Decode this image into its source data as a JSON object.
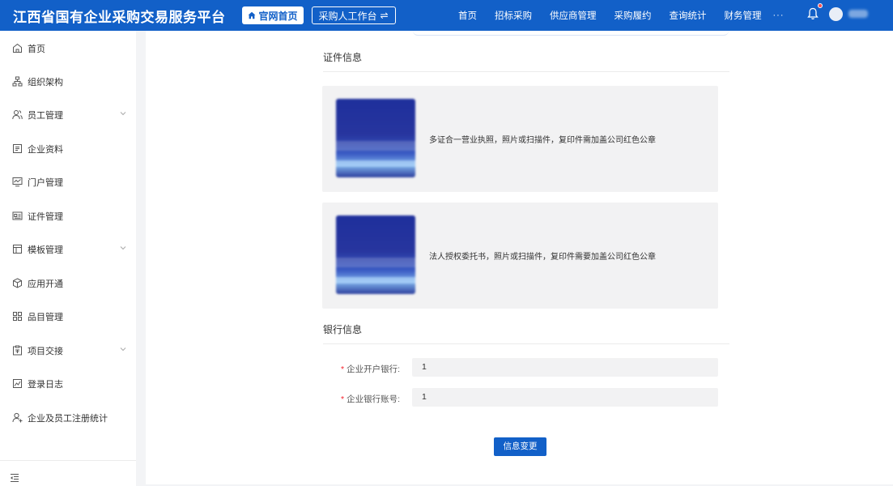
{
  "header": {
    "app_title": "江西省国有企业采购交易服务平台",
    "home_button": "官网首页",
    "switch_button": "采购人工作台",
    "nav": [
      "首页",
      "招标采购",
      "供应商管理",
      "采购履约",
      "查询统计",
      "财务管理"
    ],
    "more": "···",
    "icons": {
      "home": "home-icon",
      "switch": "switch-arrows-icon",
      "bell": "bell-icon",
      "avatar": "avatar"
    },
    "colors": {
      "brand": "#1260c8",
      "notification_dot": "#ff4d4f"
    }
  },
  "sidebar": {
    "items": [
      {
        "label": "首页",
        "icon": "home-outline-icon",
        "expandable": false
      },
      {
        "label": "组织架构",
        "icon": "org-chart-icon",
        "expandable": false
      },
      {
        "label": "员工管理",
        "icon": "users-icon",
        "expandable": true
      },
      {
        "label": "企业资料",
        "icon": "document-icon",
        "expandable": false
      },
      {
        "label": "门户管理",
        "icon": "monitor-icon",
        "expandable": false
      },
      {
        "label": "证件管理",
        "icon": "id-card-icon",
        "expandable": false
      },
      {
        "label": "模板管理",
        "icon": "template-icon",
        "expandable": true
      },
      {
        "label": "应用开通",
        "icon": "cube-icon",
        "expandable": false
      },
      {
        "label": "品目管理",
        "icon": "grid-icon",
        "expandable": false
      },
      {
        "label": "项目交接",
        "icon": "clipboard-icon",
        "expandable": true
      },
      {
        "label": "登录日志",
        "icon": "chart-icon",
        "expandable": false
      },
      {
        "label": "企业及员工注册统计",
        "icon": "user-plus-icon",
        "expandable": false
      }
    ],
    "collapse_icon": "menu-collapse-icon"
  },
  "main": {
    "certificates_title": "证件信息",
    "documents": [
      {
        "description": "多证合一营业执照，照片或扫描件，复印件需加盖公司红色公章"
      },
      {
        "description": "法人授权委托书，照片或扫描件，复印件需要加盖公司红色公章"
      }
    ],
    "bank_title": "银行信息",
    "bank_fields": [
      {
        "label": "企业开户银行:",
        "value": "1",
        "required": true
      },
      {
        "label": "企业银行账号:",
        "value": "1",
        "required": true
      }
    ],
    "required_mark": "*",
    "submit_label": "信息变更"
  }
}
